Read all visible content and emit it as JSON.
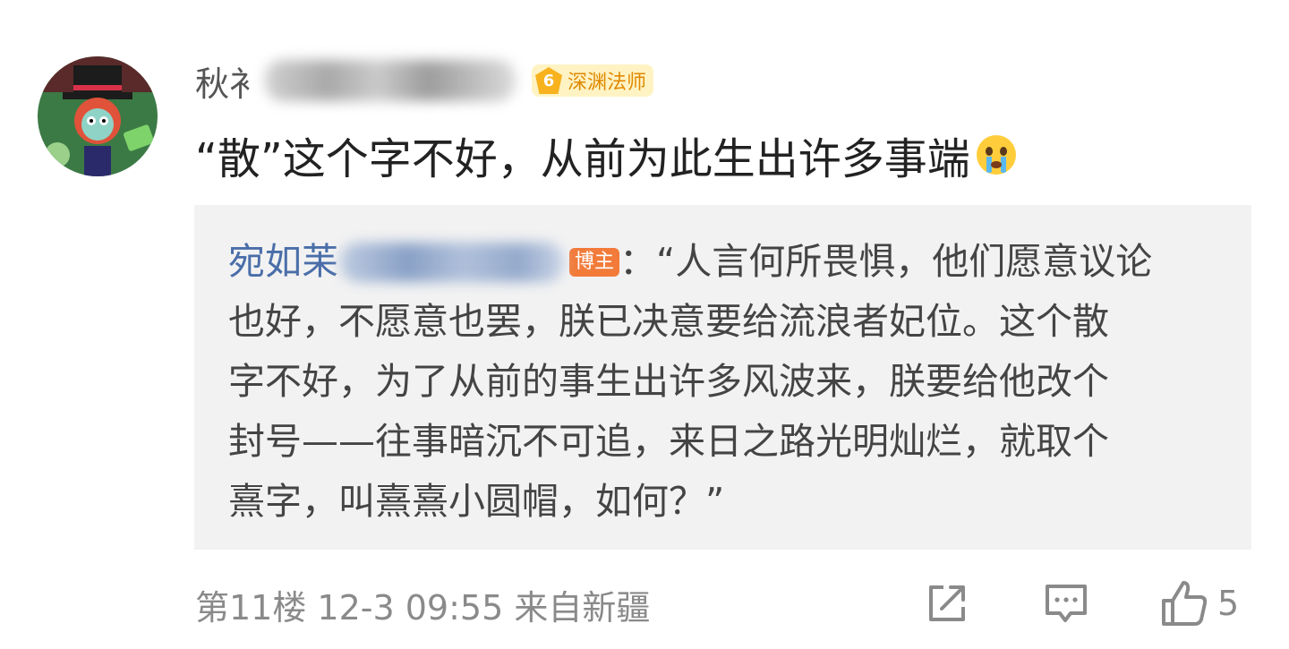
{
  "comment": {
    "username_visible": "秋衤",
    "level": "6",
    "level_title": "深渊法师",
    "text": "“散”这个字不好，从前为此生出许多事端",
    "emoji": "crying-face-emoji"
  },
  "quote": {
    "author_visible": "宛如苿",
    "author_badge": "博主",
    "separator": "：",
    "lines": [
      "“人言何所畏惧，他们愿意议论",
      "也好，不愿意也罢，朕已决意要给流浪者妃位。这个散",
      "字不好，为了从前的事生出许多风波来，朕要给他改个",
      "封号——往事暗沉不可追，来日之路光明灿烂，就取个",
      "熹字，叫熹熹小圆帽，如何？”"
    ]
  },
  "footer": {
    "meta": "第11楼 12-3 09:55 来自新疆",
    "like_count": "5"
  },
  "icons": {
    "share": "share-icon",
    "comment": "comment-icon",
    "like": "thumbs-up-icon"
  },
  "colors": {
    "author_link": "#4a6ea9",
    "badge_orange": "#f27b3a",
    "level_gold": "#f7b21d",
    "quote_bg": "#f2f2f2",
    "meta_gray": "#8a8a8a"
  }
}
